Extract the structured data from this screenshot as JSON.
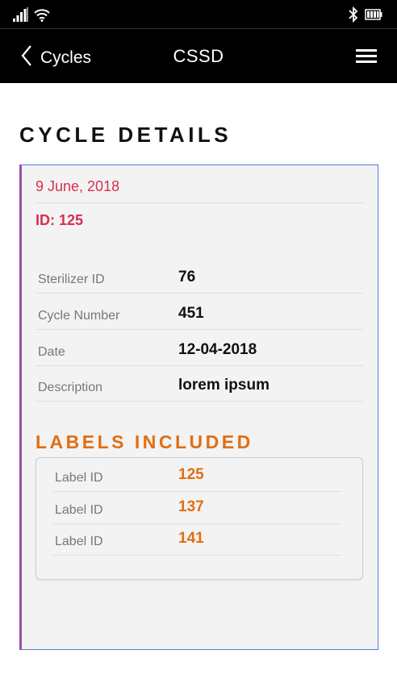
{
  "status_bar": {
    "icons": [
      "signal-icon",
      "wifi-icon",
      "bluetooth-icon",
      "battery-icon"
    ]
  },
  "nav": {
    "back_label": "Cycles",
    "title": "CSSD",
    "menu_icon": "hamburger-menu-icon"
  },
  "page": {
    "title": "CYCLE DETAILS"
  },
  "cycle": {
    "date": "9 June, 2018",
    "id": "ID: 125",
    "details": [
      {
        "label": "Sterilizer ID",
        "value": "76"
      },
      {
        "label": "Cycle Number",
        "value": "451"
      },
      {
        "label": "Date",
        "value": "12-04-2018"
      },
      {
        "label": "Description",
        "value": "lorem ipsum"
      }
    ]
  },
  "labels": {
    "heading": "LABELS INCLUDED",
    "items": [
      {
        "label": "Label ID",
        "value": "125"
      },
      {
        "label": "Label ID",
        "value": "137"
      },
      {
        "label": "Label ID",
        "value": "141"
      }
    ]
  },
  "colors": {
    "accent_red": "#d6304f",
    "accent_orange": "#e26e12",
    "card_border": "#4a7fd4",
    "card_left_border": "#9b4fa6"
  }
}
